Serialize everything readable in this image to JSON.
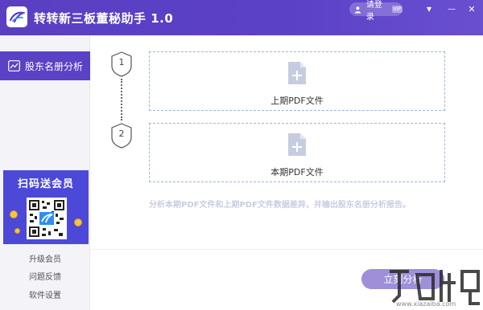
{
  "app": {
    "title": "转转新三板董秘助手 1.0"
  },
  "titlebar": {
    "login_label": "请登录",
    "vip_tag": "VIP",
    "menu_glyph": "▾",
    "minimize_glyph": "—",
    "close_glyph": "✕"
  },
  "sidebar": {
    "active_item": "股东名册分析",
    "promo_title": "扫码送会员",
    "links": [
      "升级会员",
      "问题反馈",
      "软件设置"
    ]
  },
  "steps": [
    {
      "number": "1",
      "label": "上期PDF文件"
    },
    {
      "number": "2",
      "label": "本期PDF文件"
    }
  ],
  "hint": "分析本期PDF文件和上期PDF文件数据差异，并输出股东名册分析报告。",
  "analyze_button": "立刻分析",
  "watermark": {
    "site": "www.xiazaiba.com"
  },
  "colors": {
    "brand": "#5b41c6",
    "button": "#9e8fd8",
    "dashed_border": "#9fb6d8",
    "file_icon": "#c7cde0"
  }
}
